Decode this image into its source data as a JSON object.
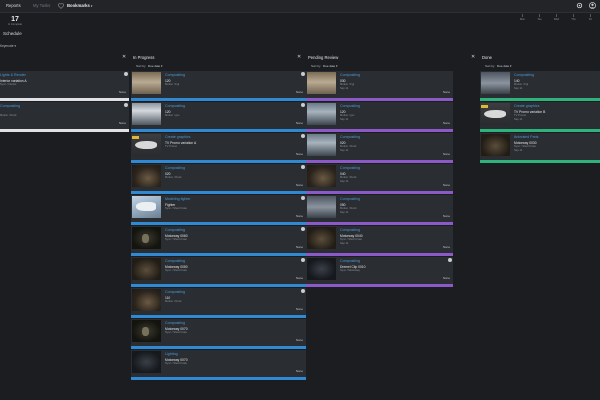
{
  "nav": {
    "reports": "Reports",
    "my_tasks": "My Tasks",
    "bookmarks": "Bookmarks",
    "caret": "▾"
  },
  "counter": {
    "value": "17",
    "label": "In Complete"
  },
  "schedule_label": "Schedule",
  "mode_label": "Keymode",
  "mode_caret": "▾",
  "timeline": [
    "Mon",
    "Tue",
    "Wed",
    "Thu",
    "Fri"
  ],
  "colors": {
    "blue": "#2f8ad3",
    "purple": "#8b59c8",
    "green": "#2fb37c",
    "white": "#dfe1e4",
    "link": "#4a9bd8"
  },
  "partial_column": {
    "cards": [
      {
        "cat": "Lights & Render",
        "name": "Interior variation A",
        "sub": "Sync / Interior",
        "status": "None",
        "bar": "white"
      },
      {
        "cat": "Compositing",
        "name": "",
        "sub": "Motion / Dock",
        "status": "None",
        "bar": "white"
      }
    ]
  },
  "columns": [
    {
      "title": "In Progress",
      "close": "✕",
      "sort_by": "Sort by",
      "sort_value": "Due date ▾",
      "cards": [
        {
          "cat": "Compositing",
          "name": "120",
          "sub": "Motion / Fgi",
          "sub2": "",
          "status": "None",
          "bar": "blue",
          "thumb": "a",
          "dot": true
        },
        {
          "cat": "Compositing",
          "name": "120",
          "sub": "Motion / gvc",
          "sub2": "",
          "status": "None",
          "bar": "blue",
          "thumb": "b",
          "dot": true
        },
        {
          "cat": "Create graphics",
          "name": "TV Promo variation A",
          "sub": "TV Promo",
          "sub2": "",
          "status": "None",
          "bar": "blue",
          "thumb": "c",
          "dot": true
        },
        {
          "cat": "Compositing",
          "name": "020",
          "sub": "Motion / Dock",
          "sub2": "",
          "status": "None",
          "bar": "blue",
          "thumb": "d",
          "dot": true
        },
        {
          "cat": "Modeling fighter",
          "name": "Fighter",
          "sub": "Sync / Shed Crate",
          "sub2": "",
          "status": "None",
          "bar": "blue",
          "thumb": "e",
          "dot": true
        },
        {
          "cat": "Compositing",
          "name": "Motorway 0060",
          "sub": "Sync / Shed Crate",
          "sub2": "",
          "status": "None",
          "bar": "blue",
          "thumb": "f",
          "dot": true
        },
        {
          "cat": "Compositing",
          "name": "Motorway 0050",
          "sub": "Sync / Shed Crate",
          "sub2": "",
          "status": "None",
          "bar": "blue",
          "thumb": "g",
          "dot": true
        },
        {
          "cat": "Compositing",
          "name": "110",
          "sub": "Motion / Dock",
          "sub2": "",
          "status": "None",
          "bar": "blue",
          "thumb": "d",
          "dot": true
        },
        {
          "cat": "Compositing",
          "name": "Motorway 0070",
          "sub": "Sync / Shed Crate",
          "sub2": "",
          "status": "None",
          "bar": "blue",
          "thumb": "f",
          "dot": false
        },
        {
          "cat": "Lighting",
          "name": "Motorway 0070",
          "sub": "Sync / Shed Crate",
          "sub2": "",
          "status": "None",
          "bar": "blue",
          "thumb": "i",
          "dot": false
        }
      ]
    },
    {
      "title": "Pending Review",
      "close": "✕",
      "sort_by": "Sort by",
      "sort_value": "Due date ▾",
      "cards": [
        {
          "cat": "Compositing",
          "name": "030",
          "sub": "Motion / Fgi",
          "sub2": "Sep 11",
          "status": "None",
          "bar": "purple",
          "thumb": "a",
          "dot": false
        },
        {
          "cat": "Compositing",
          "name": "120",
          "sub": "Motion / gvc",
          "sub2": "Sep 11",
          "status": "None",
          "bar": "purple",
          "thumb": "h",
          "dot": false
        },
        {
          "cat": "Compositing",
          "name": "020",
          "sub": "Motion / Dock",
          "sub2": "Sep 11",
          "status": "None",
          "bar": "purple",
          "thumb": "h",
          "dot": false
        },
        {
          "cat": "Compositing",
          "name": "040",
          "sub": "Motion / Dock",
          "sub2": "Sep 11",
          "status": "None",
          "bar": "purple",
          "thumb": "d",
          "dot": false
        },
        {
          "cat": "Compositing",
          "name": "050",
          "sub": "Motion / Dock",
          "sub2": "Sep 11",
          "status": "None",
          "bar": "purple",
          "thumb": "j",
          "dot": false
        },
        {
          "cat": "Compositing",
          "name": "Motorway 0040",
          "sub": "Sync / Shed Crate",
          "sub2": "Sep 11",
          "status": "None",
          "bar": "purple",
          "thumb": "g",
          "dot": false
        },
        {
          "cat": "Compositing",
          "name": "Dremel Clip 0010",
          "sub": "Sync / Motorway",
          "sub2": "",
          "status": "None",
          "bar": "purple",
          "thumb": "i",
          "dot": true
        }
      ]
    },
    {
      "title": "Done",
      "close": "✕",
      "sort_by": "Sort by",
      "sort_value": "Due date ▾",
      "cards": [
        {
          "cat": "Compositing",
          "name": "140",
          "sub": "Motion / Fgi",
          "sub2": "Sep 11",
          "status": "",
          "bar": "green",
          "thumb": "j",
          "dot": false
        },
        {
          "cat": "Create graphics",
          "name": "TV Promo variation B",
          "sub": "TV Promo",
          "sub2": "Sep 11",
          "status": "",
          "bar": "green",
          "thumb": "c",
          "dot": false
        },
        {
          "cat": "Animated Parts",
          "name": "Motorway 0030",
          "sub": "Sync / Shed Crate",
          "sub2": "Sep 11",
          "status": "",
          "bar": "green",
          "thumb": "g",
          "dot": false
        }
      ]
    }
  ]
}
